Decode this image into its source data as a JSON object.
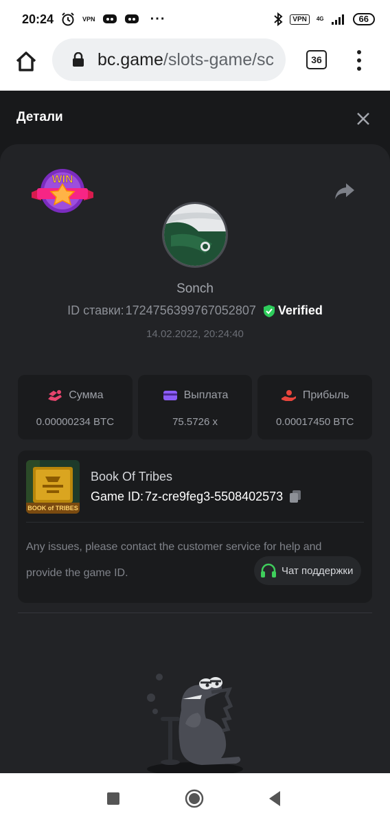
{
  "status_bar": {
    "time": "20:24",
    "vpn_small": "VPN",
    "vpn_box": "VPN",
    "network": "4G",
    "battery": "66"
  },
  "browser": {
    "url_domain": "bc.game",
    "url_path": "/slots-game/sc",
    "tab_count": "36"
  },
  "header": {
    "title": "Детали"
  },
  "bet": {
    "badge_text": "WIN",
    "username": "Sonch",
    "id_label": "ID ставки:",
    "id_value": "1724756399767052807",
    "verified_label": "Verified",
    "datetime": "14.02.2022, 20:24:40"
  },
  "stats": {
    "amount_label": "Сумма",
    "amount_value": "0.00000234 BTC",
    "payout_label": "Выплата",
    "payout_value": "75.5726 x",
    "profit_label": "Прибыль",
    "profit_value": "0.00017450 BTC"
  },
  "game": {
    "name": "Book Of Tribes",
    "thumb_text": "BOOK of TRIBES",
    "id_label": "Game ID:",
    "id_value": "7z-cre9feg3-5508402573",
    "help_text": "Any issues, please contact the customer service for help and provide the game ID.",
    "support_label": "Чат поддержки"
  },
  "colors": {
    "background": "#18191b",
    "panel": "#222326",
    "card": "#1a1b1d",
    "verified_green": "#2ecc5b",
    "amount_pink": "#e8456e",
    "payout_purple": "#8b5cf6",
    "profit_red": "#e8453c",
    "support_green": "#3fcf5c"
  }
}
